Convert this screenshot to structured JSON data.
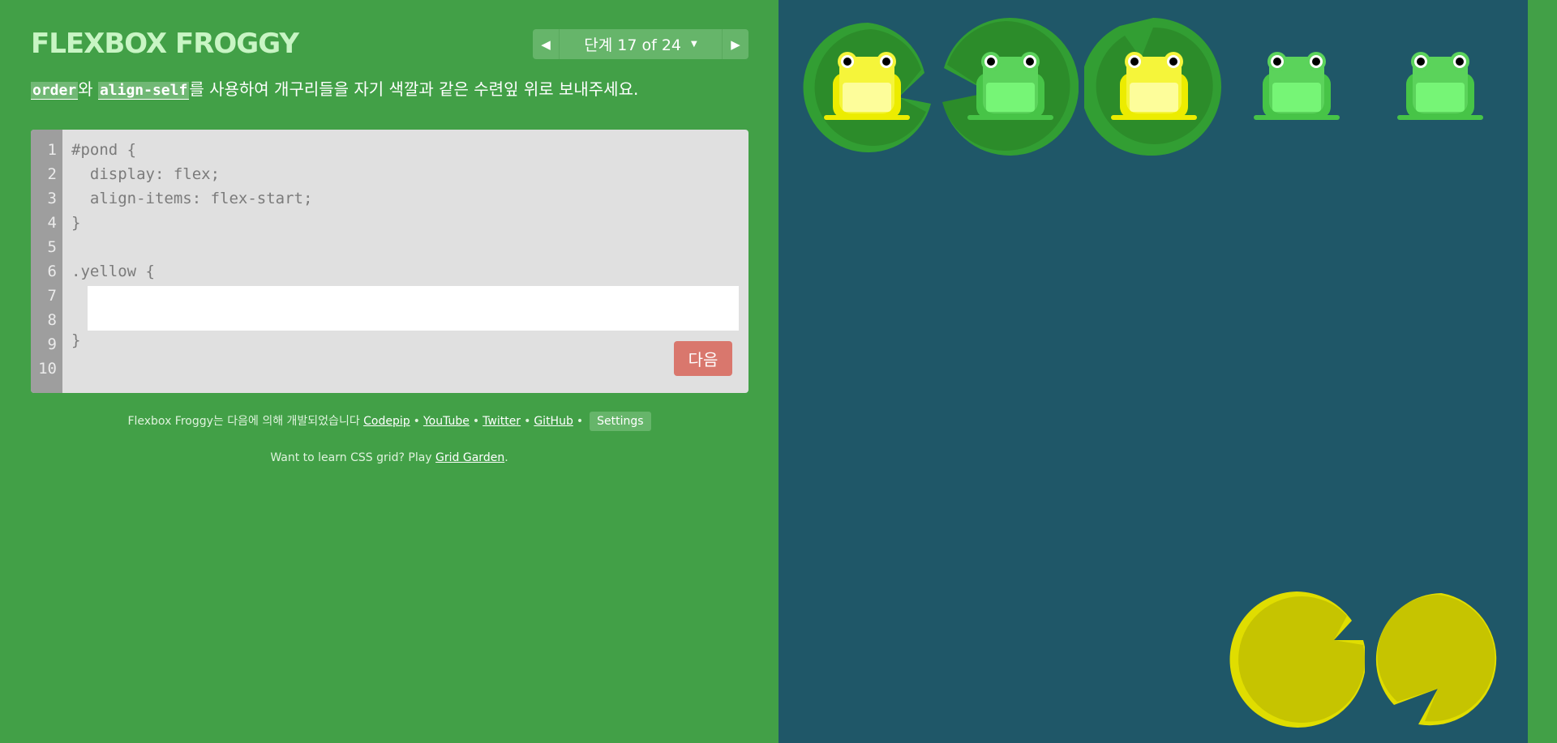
{
  "header": {
    "title": "Flexbox Froggy",
    "level_label": "단계 17 of 24"
  },
  "instructions": {
    "code_1": "order",
    "text_1": "와 ",
    "code_2": "align-self",
    "text_2": "를 사용하여 개구리들을 자기 색깔과 같은 수련잎 위로 보내주세요."
  },
  "editor": {
    "line_numbers": [
      "1",
      "2",
      "3",
      "4",
      "5",
      "6",
      "7",
      "8",
      "9",
      "10"
    ],
    "code_lines": [
      "#pond {",
      "  display: flex;",
      "  align-items: flex-start;",
      "}",
      "",
      ".yellow {",
      "",
      "",
      "}"
    ],
    "input_value": "",
    "next_label": "다음"
  },
  "footer": {
    "credits_text": "Flexbox Froggy는 다음에 의해 개발되었습니다 ",
    "link_codepip": "Codepip",
    "link_youtube": "YouTube",
    "link_twitter": "Twitter",
    "link_github": "GitHub",
    "separator": "•",
    "settings_label": "Settings",
    "promo_text": "Want to learn CSS grid? Play ",
    "promo_link": "Grid Garden",
    "promo_end": "."
  },
  "colors": {
    "green_pad": "#2c8c2a",
    "yellow_pad": "#c6c400",
    "green_frog": "#5bd35b",
    "yellow_frog": "#f5f53a",
    "pond": "#1f5768",
    "background": "#42a047"
  },
  "pond": {
    "frogs": [
      {
        "color": "yellow",
        "on_pad": true
      },
      {
        "color": "green",
        "on_pad": true
      },
      {
        "color": "yellow",
        "on_pad": true
      },
      {
        "color": "green",
        "on_pad": false
      },
      {
        "color": "green",
        "on_pad": false
      }
    ],
    "yellow_pads": 2
  }
}
